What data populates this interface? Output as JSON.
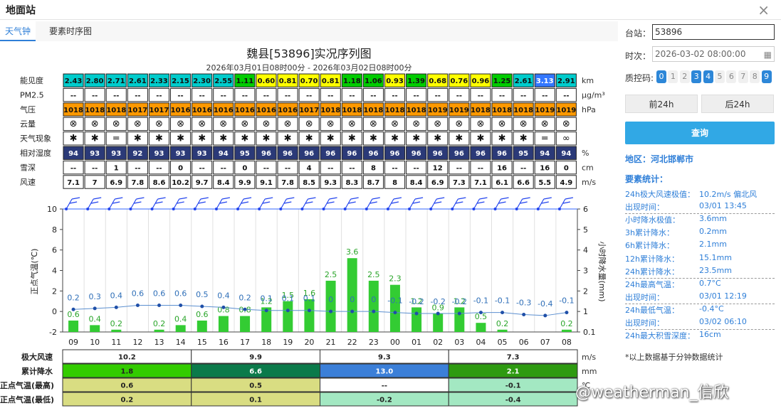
{
  "window": {
    "title": "地面站",
    "close": "×"
  },
  "tabs": [
    "天气钟",
    "要素时序图"
  ],
  "chart_title": "魏县[53896]实况序列图",
  "chart_subtitle": "2026年03月01日08时00分 - 2026年03月02日08时00分",
  "colors": {
    "accent": "#2f7fd8",
    "button": "#31a8e5",
    "vis_low": "#ffff00",
    "vis_mid": "#00cc00",
    "vis_high": "#00cccc",
    "vis_top": "#3377ff",
    "pressure": "#ff9900",
    "humidity": "#2b3a78",
    "bar": "#33cc33",
    "temp_line": "#2f6fb8"
  },
  "hours": [
    "09",
    "10",
    "11",
    "12",
    "13",
    "14",
    "15",
    "16",
    "17",
    "18",
    "19",
    "20",
    "21",
    "22",
    "23",
    "00",
    "01",
    "02",
    "03",
    "04",
    "05",
    "06",
    "07",
    "08"
  ],
  "table": {
    "rows": [
      {
        "label": "能见度",
        "unit": "km"
      },
      {
        "label": "PM2.5",
        "unit": "μg/m³"
      },
      {
        "label": "气压",
        "unit": "hPa"
      },
      {
        "label": "云量",
        "unit": ""
      },
      {
        "label": "天气现象",
        "unit": ""
      },
      {
        "label": "相对湿度",
        "unit": "%"
      },
      {
        "label": "雪深",
        "unit": "cm"
      },
      {
        "label": "风速",
        "unit": "m/s"
      }
    ],
    "visibility": [
      "2.43",
      "2.80",
      "2.71",
      "2.61",
      "2.33",
      "2.15",
      "2.30",
      "2.55",
      "1.11",
      "0.60",
      "0.81",
      "0.70",
      "0.81",
      "1.18",
      "1.06",
      "0.93",
      "1.39",
      "0.68",
      "0.76",
      "0.96",
      "1.25",
      "2.61",
      "3.13",
      "2.91"
    ],
    "pm25": [
      "--",
      "--",
      "--",
      "--",
      "--",
      "--",
      "--",
      "--",
      "--",
      "--",
      "--",
      "--",
      "--",
      "--",
      "--",
      "--",
      "--",
      "--",
      "--",
      "--",
      "--",
      "--",
      "--",
      "--"
    ],
    "pressure": [
      "1018",
      "1018",
      "1018",
      "1017",
      "1017",
      "1016",
      "1016",
      "1016",
      "1016",
      "1016",
      "1016",
      "1017",
      "1018",
      "1018",
      "1018",
      "1018",
      "1018",
      "1019",
      "1019",
      "1018",
      "1018",
      "1018",
      "1019",
      "1019"
    ],
    "cloud": [
      "⊗",
      "⊗",
      "⊗",
      "⊗",
      "⊗",
      "⊗",
      "⊗",
      "⊗",
      "⊗",
      "⊗",
      "⊗",
      "⊗",
      "⊗",
      "⊗",
      "⊗",
      "⊗",
      "⊗",
      "⊗",
      "⊗",
      "⊗",
      "⊗",
      "⊗",
      "⊗",
      "⊗"
    ],
    "weather": [
      "✱",
      "✱",
      "=",
      "✱",
      "✱",
      "✱",
      "✱",
      "✱",
      "✱",
      "✱",
      "✱",
      "✱",
      "✱",
      "✱",
      "✱",
      "✱",
      "✱",
      "✱",
      "✱",
      "✱",
      "✱",
      "✱",
      "=",
      "∞"
    ],
    "humidity": [
      "94",
      "93",
      "93",
      "92",
      "93",
      "93",
      "93",
      "94",
      "95",
      "96",
      "96",
      "96",
      "96",
      "96",
      "96",
      "96",
      "96",
      "96",
      "96",
      "96",
      "96",
      "95",
      "94",
      "94"
    ],
    "snow": [
      "--",
      "--",
      "1",
      "--",
      "--",
      "0",
      "--",
      "--",
      "0",
      "--",
      "--",
      "4",
      "--",
      "--",
      "8",
      "--",
      "--",
      "12",
      "--",
      "--",
      "16",
      "--",
      "16",
      "0"
    ],
    "wind": [
      "7.1",
      "7",
      "6.9",
      "7.8",
      "8.6",
      "10.2",
      "9.7",
      "8.4",
      "9.9",
      "9.1",
      "7.8",
      "8.5",
      "9.3",
      "8.3",
      "8.7",
      "8",
      "8.4",
      "6.9",
      "7.3",
      "7.1",
      "6.1",
      "6.6",
      "5.5",
      "4.9"
    ]
  },
  "chart_data": {
    "type": "bar",
    "categories": [
      "09",
      "10",
      "11",
      "12",
      "13",
      "14",
      "15",
      "16",
      "17",
      "18",
      "19",
      "20",
      "21",
      "22",
      "23",
      "00",
      "01",
      "02",
      "03",
      "04",
      "05",
      "06",
      "07",
      "08"
    ],
    "ylabel": "正点气温(℃)",
    "ylabel2": "小时降水量(mm)",
    "ylim": [
      -2,
      10
    ],
    "y_ticks": [
      "10",
      "8",
      "6",
      "4",
      "2",
      "0",
      "-2"
    ],
    "y2_ticks": [
      "6",
      "5",
      "4",
      "3",
      "2",
      "1",
      "0.1"
    ],
    "temperature_labels": [
      "0.2",
      "0.3",
      "0.4",
      "0.6",
      "0.6",
      "0.6",
      "0.5",
      "0.4",
      "0.2",
      "0.1",
      "0.1",
      "0.1",
      "0",
      "0",
      "0",
      "-0.1",
      "-0.2",
      "-0.2",
      "-0.2",
      "-0.1",
      "-0.1",
      "-0.3",
      "-0.4",
      "-0.1"
    ],
    "temperature": [
      0.2,
      0.3,
      0.4,
      0.6,
      0.6,
      0.6,
      0.5,
      0.4,
      0.2,
      0.1,
      0.1,
      0.1,
      0,
      0,
      0,
      -0.1,
      -0.2,
      -0.2,
      -0.2,
      -0.1,
      -0.1,
      -0.3,
      -0.4,
      -0.1
    ],
    "precip_labels": [
      "0.6",
      "0.4",
      "0.2",
      "",
      "0.2",
      "0.4",
      "0.6",
      "0.8",
      "0.8",
      "1.2",
      "1.5",
      "1.6",
      "2.5",
      "3.6",
      "2.5",
      "2.3",
      "1.2",
      "0.9",
      "1.2",
      "0.5",
      "0.2",
      "",
      "",
      "0.2"
    ],
    "precip": [
      0.6,
      0.4,
      0.2,
      0,
      0.2,
      0.4,
      0.6,
      0.8,
      0.8,
      1.2,
      1.5,
      1.6,
      2.5,
      3.6,
      2.5,
      2.3,
      1.2,
      0.9,
      1.2,
      0.5,
      0.2,
      0,
      0,
      0.2
    ],
    "grid": true
  },
  "bottom": {
    "rows": [
      {
        "label": "极大风速",
        "unit": "m/s",
        "values": [
          "10.2",
          "9.9",
          "9.3",
          "7.3"
        ]
      },
      {
        "label": "累计降水",
        "unit": "mm",
        "values": [
          "1.8",
          "6.6",
          "13.0",
          "2.1"
        ]
      },
      {
        "label": "正点气温(最高)",
        "unit": "℃",
        "values": [
          "0.6",
          "0.5",
          "--",
          "-0.1"
        ]
      },
      {
        "label": "正点气温(最低)",
        "unit": "",
        "values": [
          "0.2",
          "0.1",
          "-0.2",
          "-0.4"
        ]
      }
    ]
  },
  "side": {
    "station_label": "台站：",
    "station_value": "53896",
    "time_label": "时次：",
    "time_value": "2026-03-02 08:00:00",
    "qc_label": "质控码:",
    "qc_codes": [
      "0",
      "1",
      "2",
      "3",
      "4",
      "5",
      "6",
      "7",
      "8",
      "9"
    ],
    "qc_on": [
      0,
      3,
      4,
      9
    ],
    "prev_label": "前24h",
    "next_label": "后24h",
    "query_label": "查询",
    "region": "地区：河北邯郸市",
    "stats_title": "要素统计：",
    "stats": [
      {
        "k": "24h极大风速极值：",
        "v": "10.2m/s 偏北风",
        "div": false
      },
      {
        "k": "出现时间：",
        "v": "03/01 13:45",
        "div": true
      },
      {
        "k": "小时降水极值：",
        "v": "3.6mm",
        "div": false
      },
      {
        "k": "3h累计降水：",
        "v": "0.2mm",
        "div": false
      },
      {
        "k": "6h累计降水：",
        "v": "2.1mm",
        "div": false
      },
      {
        "k": "12h累计降水：",
        "v": "15.1mm",
        "div": false
      },
      {
        "k": "24h累计降水：",
        "v": "23.5mm",
        "div": true
      },
      {
        "k": "24h最高气温：",
        "v": "0.7°C",
        "div": false
      },
      {
        "k": "出现时间：",
        "v": "03/01 12:19",
        "div": true
      },
      {
        "k": "24h最低气温：",
        "v": "-0.4°C",
        "div": false
      },
      {
        "k": "出现时间：",
        "v": "03/02 06:10",
        "div": true
      },
      {
        "k": "24h最大积雪深度：",
        "v": "16cm",
        "div": false
      }
    ],
    "note": "*以上数据基于分钟数据统计"
  },
  "watermark": "@weatherman_信欣"
}
